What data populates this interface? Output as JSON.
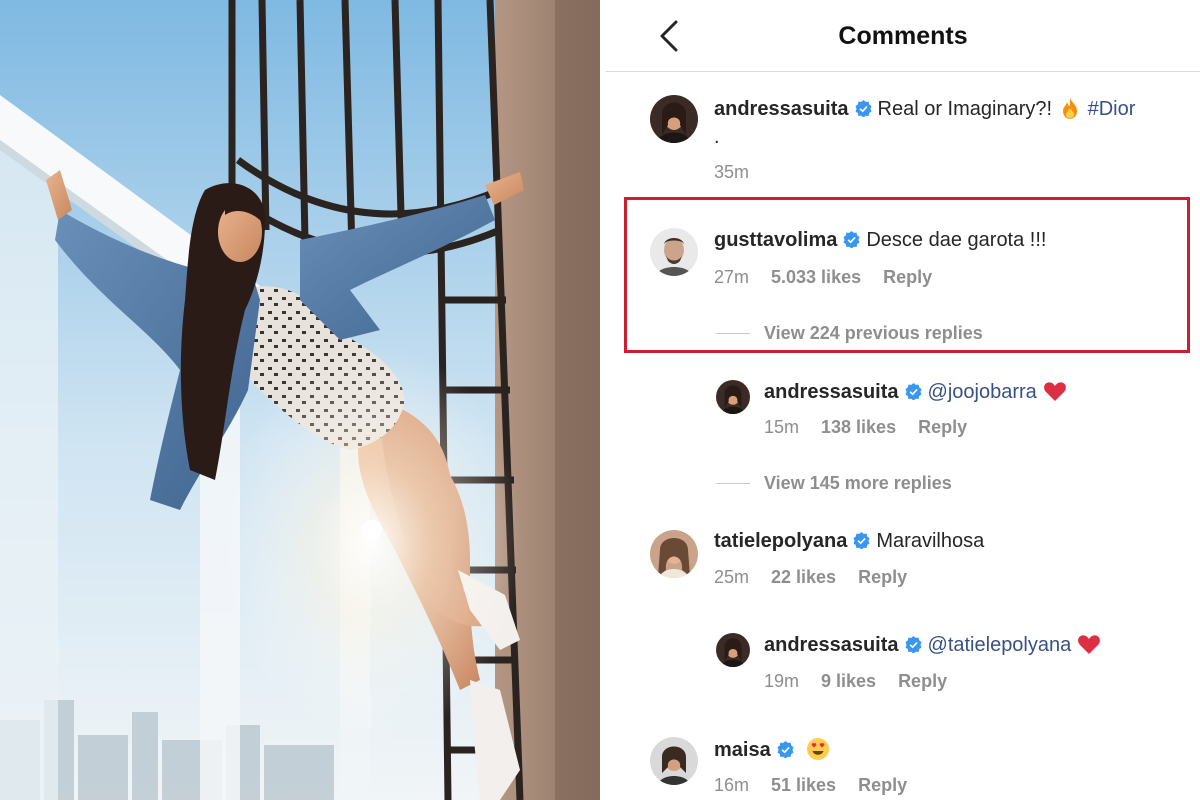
{
  "header": {
    "title": "Comments"
  },
  "icons": {
    "back": "chevron-left-icon",
    "verified": "verified-badge-icon",
    "fire": "fire-emoji-icon",
    "heart": "red-heart-emoji-icon",
    "heart_eyes": "heart-eyes-emoji-icon"
  },
  "colors": {
    "accent": "#3897f0",
    "highlight_border": "#c8202f",
    "hashtag": "#385185",
    "meta": "#8e8e8e"
  },
  "caption": {
    "username": "andressasuita",
    "text": "Real or Imaginary?!",
    "hashtag": "#Dior",
    "line2": ".",
    "time": "35m"
  },
  "comments": [
    {
      "username": "gusttavolima",
      "text": "Desce dae garota !!!",
      "time": "27m",
      "likes": "5.033 likes",
      "reply": "Reply",
      "view_replies": "View 224 previous replies",
      "replies": [
        {
          "username": "andressasuita",
          "mention": "@joojobarra",
          "time": "15m",
          "likes": "138 likes",
          "reply": "Reply"
        }
      ],
      "more_replies": "View 145 more replies"
    },
    {
      "username": "tatielepolyana",
      "text": "Maravilhosa",
      "time": "25m",
      "likes": "22 likes",
      "reply": "Reply",
      "replies": [
        {
          "username": "andressasuita",
          "mention": "@tatielepolyana",
          "time": "19m",
          "likes": "9 likes",
          "reply": "Reply"
        }
      ]
    },
    {
      "username": "maisa",
      "text": "",
      "time": "16m",
      "likes": "51 likes",
      "reply": "Reply"
    }
  ]
}
